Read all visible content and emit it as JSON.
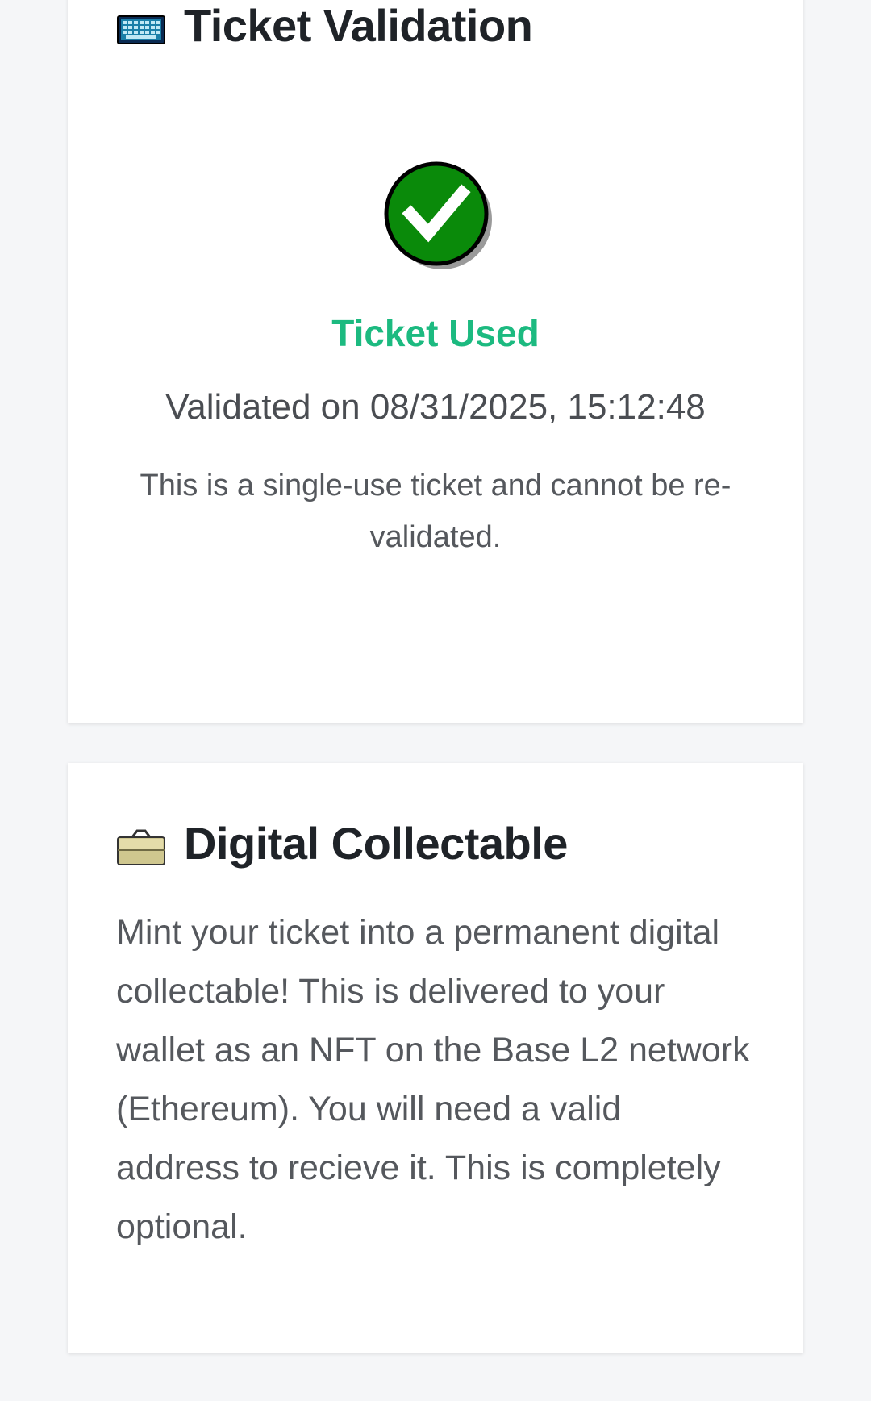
{
  "validation_card": {
    "title": "Ticket Validation",
    "title_icon": "keyboard-icon",
    "status_icon": "checkmark-circle-icon",
    "status": "Ticket Used",
    "validated_at": "Validated on 08/31/2025, 15:12:48",
    "note": "This is a single-use ticket and cannot be re-validated.",
    "status_color": "#1cba80"
  },
  "collectable_card": {
    "title": "Digital Collectable",
    "title_icon": "briefcase-icon",
    "description": "Mint your ticket into a permanent digital collectable! This is delivered to your wallet as an NFT on the Base L2 network (Ethereum). You will need a valid address to recieve it. This is completely optional."
  }
}
